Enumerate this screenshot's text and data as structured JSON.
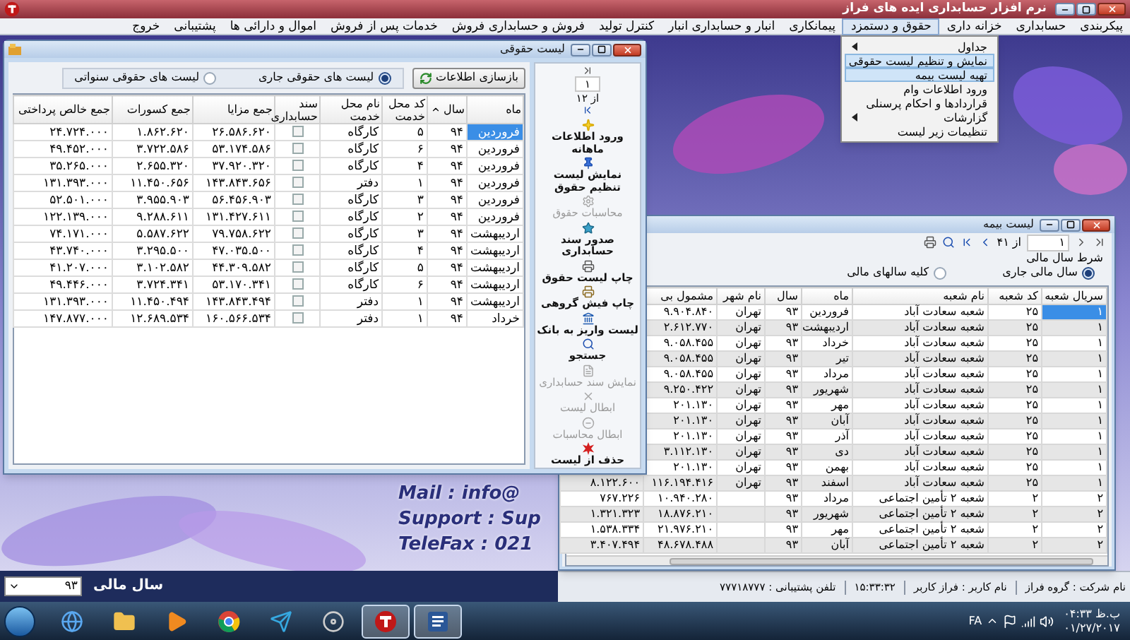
{
  "app_window": {
    "title": "نرم افزار حسابداری ایده های فراز"
  },
  "menu_bar": [
    {
      "label": "پیکربندی",
      "selected": false
    },
    {
      "label": "حسابداری",
      "selected": false
    },
    {
      "label": "خزانه داری",
      "selected": false
    },
    {
      "label": "حقوق و دستمزد",
      "selected": true
    },
    {
      "label": "پیمانکاری",
      "selected": false
    },
    {
      "label": "انبار و حسابداری انبار",
      "selected": false
    },
    {
      "label": "کنترل تولید",
      "selected": false
    },
    {
      "label": "فروش و حسابداری فروش",
      "selected": false
    },
    {
      "label": "خدمات پس از فروش",
      "selected": false
    },
    {
      "label": "اموال و دارائی ها",
      "selected": false
    },
    {
      "label": "پشتیبانی",
      "selected": false
    },
    {
      "label": "خروج",
      "selected": false
    }
  ],
  "dropdown_menu": [
    {
      "label": "جداول",
      "submenu": true,
      "selected": false
    },
    {
      "label": "نمایش و تنظیم لیست حقوقی",
      "submenu": false,
      "selected": true
    },
    {
      "label": "تهیه لیست بیمه",
      "submenu": false,
      "selected": true
    },
    {
      "label": "ورود اطلاعات وام",
      "submenu": false,
      "selected": false
    },
    {
      "label": "قراردادها و احکام پرسنلی",
      "submenu": false,
      "selected": false
    },
    {
      "label": "گزارشات",
      "submenu": true,
      "selected": false
    },
    {
      "label": "تنظیمات زیر لیست",
      "submenu": false,
      "selected": false
    }
  ],
  "payroll_window": {
    "title": "لیست حقوقی",
    "rebuild_button": "بازسازی اطلاعات",
    "list_options": [
      {
        "label": "لیست های حقوقی جاری",
        "selected": true
      },
      {
        "label": "لیست های حقوقی سنواتی",
        "selected": false
      }
    ],
    "navigator": {
      "page": "۱",
      "total": "از ۱۲"
    },
    "actions": [
      {
        "label": "ورود اطلاعات ماهانه",
        "disabled": false
      },
      {
        "label": "نمایش لیست تنظیم حقوق",
        "disabled": false
      },
      {
        "label": "محاسبات حقوق",
        "disabled": true
      },
      {
        "label": "صدور سند حسابداری",
        "disabled": false
      },
      {
        "label": "چاپ لیست حقوق",
        "disabled": false
      },
      {
        "label": "چاپ فیش گروهی",
        "disabled": false
      },
      {
        "label": "لیست واریز به بانک",
        "disabled": false
      },
      {
        "label": "جستجو",
        "disabled": false
      },
      {
        "label": "نمایش سند حسابداری",
        "disabled": true
      },
      {
        "label": "ابطال لیست",
        "disabled": true
      },
      {
        "label": "ابطال محاسبات",
        "disabled": true
      },
      {
        "label": "حذف از لیست",
        "disabled": false
      }
    ],
    "table": {
      "columns": [
        "ماه",
        "سال",
        "کد محل خدمت",
        "نام محل خدمت",
        "سند حسابداری",
        "جمع مزایا",
        "جمع کسورات",
        "جمع خالص پرداختی"
      ],
      "rows": [
        {
          "month": "فروردین",
          "year": "۹۴",
          "code": "۵",
          "place": "کارگاه",
          "checked": false,
          "benefits": "۲۶.۵۸۶.۶۲۰",
          "deductions": "۱.۸۶۲.۶۲۰",
          "net": "۲۴.۷۲۴.۰۰۰",
          "selected": true
        },
        {
          "month": "فروردین",
          "year": "۹۴",
          "code": "۶",
          "place": "کارگاه",
          "checked": false,
          "benefits": "۵۳.۱۷۴.۵۸۶",
          "deductions": "۳.۷۲۲.۵۸۶",
          "net": "۴۹.۴۵۲.۰۰۰",
          "selected": false
        },
        {
          "month": "فروردین",
          "year": "۹۴",
          "code": "۴",
          "place": "کارگاه",
          "checked": false,
          "benefits": "۳۷.۹۲۰.۳۲۰",
          "deductions": "۲.۶۵۵.۳۲۰",
          "net": "۳۵.۲۶۵.۰۰۰",
          "selected": false
        },
        {
          "month": "فروردین",
          "year": "۹۴",
          "code": "۱",
          "place": "دفتر",
          "checked": false,
          "benefits": "۱۴۳.۸۴۳.۶۵۶",
          "deductions": "۱۱.۴۵۰.۶۵۶",
          "net": "۱۳۱.۳۹۳.۰۰۰",
          "selected": false
        },
        {
          "month": "فروردین",
          "year": "۹۴",
          "code": "۳",
          "place": "کارگاه",
          "checked": false,
          "benefits": "۵۶.۴۵۶.۹۰۳",
          "deductions": "۳.۹۵۵.۹۰۳",
          "net": "۵۲.۵۰۱.۰۰۰",
          "selected": false
        },
        {
          "month": "فروردین",
          "year": "۹۴",
          "code": "۲",
          "place": "کارگاه",
          "checked": false,
          "benefits": "۱۳۱.۴۲۷.۶۱۱",
          "deductions": "۹.۲۸۸.۶۱۱",
          "net": "۱۲۲.۱۳۹.۰۰۰",
          "selected": false
        },
        {
          "month": "اردیبهشت",
          "year": "۹۴",
          "code": "۳",
          "place": "کارگاه",
          "checked": false,
          "benefits": "۷۹.۷۵۸.۶۲۲",
          "deductions": "۵.۵۸۷.۶۲۲",
          "net": "۷۴.۱۷۱.۰۰۰",
          "selected": false
        },
        {
          "month": "اردیبهشت",
          "year": "۹۴",
          "code": "۴",
          "place": "کارگاه",
          "checked": false,
          "benefits": "۴۷.۰۳۵.۵۰۰",
          "deductions": "۳.۲۹۵.۵۰۰",
          "net": "۴۳.۷۴۰.۰۰۰",
          "selected": false
        },
        {
          "month": "اردیبهشت",
          "year": "۹۴",
          "code": "۵",
          "place": "کارگاه",
          "checked": false,
          "benefits": "۴۴.۳۰۹.۵۸۲",
          "deductions": "۳.۱۰۲.۵۸۲",
          "net": "۴۱.۲۰۷.۰۰۰",
          "selected": false
        },
        {
          "month": "اردیبهشت",
          "year": "۹۴",
          "code": "۶",
          "place": "کارگاه",
          "checked": false,
          "benefits": "۵۳.۱۷۰.۳۴۱",
          "deductions": "۳.۷۲۴.۳۴۱",
          "net": "۴۹.۴۴۶.۰۰۰",
          "selected": false
        },
        {
          "month": "اردیبهشت",
          "year": "۹۴",
          "code": "۱",
          "place": "دفتر",
          "checked": false,
          "benefits": "۱۴۳.۸۴۳.۴۹۴",
          "deductions": "۱۱.۴۵۰.۴۹۴",
          "net": "۱۳۱.۳۹۳.۰۰۰",
          "selected": false
        },
        {
          "month": "خرداد",
          "year": "۹۴",
          "code": "۱",
          "place": "دفتر",
          "checked": false,
          "benefits": "۱۶۰.۵۶۶.۵۳۴",
          "deductions": "۱۲.۶۸۹.۵۳۴",
          "net": "۱۴۷.۸۷۷.۰۰۰",
          "selected": false
        }
      ]
    }
  },
  "insurance_window": {
    "title": "لیست بیمه",
    "navigator": {
      "total": "از ۴۱",
      "page": "۱"
    },
    "year_filter": {
      "title": "شرط سال مالی",
      "options": [
        {
          "label": "سال مالی جاری",
          "selected": true
        },
        {
          "label": "کلیه سالهای مالی",
          "selected": false
        }
      ]
    },
    "table": {
      "columns": [
        "سریال شعبه",
        "کد شعبه",
        "نام شعبه",
        "ماه",
        "سال",
        "نام شهر",
        "مشمول بی"
      ],
      "rows": [
        {
          "serial": "۱",
          "code": "۲۵",
          "branch": "شعبه سعادت آباد",
          "month": "فروردین",
          "year": "۹۳",
          "city": "تهران",
          "insured": "۹.۹۰۴.۸۴۰",
          "selected": true
        },
        {
          "serial": "۱",
          "code": "۲۵",
          "branch": "شعبه سعادت آباد",
          "month": "اردیبهشت",
          "year": "۹۳",
          "city": "تهران",
          "insured": "۲.۶۱۲.۷۷۰",
          "selected": false
        },
        {
          "serial": "۱",
          "code": "۲۵",
          "branch": "شعبه سعادت آباد",
          "month": "خرداد",
          "year": "۹۳",
          "city": "تهران",
          "insured": "۹.۰۵۸.۴۵۵",
          "selected": false
        },
        {
          "serial": "۱",
          "code": "۲۵",
          "branch": "شعبه سعادت آباد",
          "month": "تیر",
          "year": "۹۳",
          "city": "تهران",
          "insured": "۹.۰۵۸.۴۵۵",
          "selected": false
        },
        {
          "serial": "۱",
          "code": "۲۵",
          "branch": "شعبه سعادت آباد",
          "month": "مرداد",
          "year": "۹۳",
          "city": "تهران",
          "insured": "۹.۰۵۸.۴۵۵",
          "selected": false
        },
        {
          "serial": "۱",
          "code": "۲۵",
          "branch": "شعبه سعادت آباد",
          "month": "شهریور",
          "year": "۹۳",
          "city": "تهران",
          "insured": "۹.۲۵۰.۴۲۲",
          "selected": false
        },
        {
          "serial": "۱",
          "code": "۲۵",
          "branch": "شعبه سعادت آباد",
          "month": "مهر",
          "year": "۹۳",
          "city": "تهران",
          "insured": "۲۰۱.۱۳۰",
          "selected": false
        },
        {
          "serial": "۱",
          "code": "۲۵",
          "branch": "شعبه سعادت آباد",
          "month": "آبان",
          "year": "۹۳",
          "city": "تهران",
          "insured": "۲۰۱.۱۳۰",
          "selected": false
        },
        {
          "serial": "۱",
          "code": "۲۵",
          "branch": "شعبه سعادت آباد",
          "month": "آذر",
          "year": "۹۳",
          "city": "تهران",
          "insured": "۲۰۱.۱۳۰",
          "selected": false
        },
        {
          "serial": "۱",
          "code": "۲۵",
          "branch": "شعبه سعادت آباد",
          "month": "دی",
          "year": "۹۳",
          "city": "تهران",
          "insured": "۳.۱۱۲.۱۳۰",
          "selected": false
        },
        {
          "serial": "۱",
          "code": "۲۵",
          "branch": "شعبه سعادت آباد",
          "month": "بهمن",
          "year": "۹۳",
          "city": "تهران",
          "insured": "۲۰۱.۱۳۰",
          "selected": false
        },
        {
          "serial": "۱",
          "code": "۲۵",
          "branch": "شعبه سعادت آباد",
          "month": "اسفند",
          "year": "۹۳",
          "city": "تهران",
          "insured": "۱۱۶.۱۹۴.۴۱۶",
          "column_8": "۸.۱۲۲.۶۰۰",
          "selected": false
        },
        {
          "serial": "۲",
          "code": "۲",
          "branch": "شعبه ۲ تأمین اجتماعی",
          "month": "مرداد",
          "year": "۹۳",
          "insured": "۱۰.۹۴۰.۲۸۰",
          "column_8": "۷۶۷.۲۲۶",
          "selected": false
        },
        {
          "serial": "۲",
          "code": "۲",
          "branch": "شعبه ۲ تأمین اجتماعی",
          "month": "شهریور",
          "year": "۹۳",
          "insured": "۱۸.۸۷۶.۲۱۰",
          "column_8": "۱.۳۲۱.۳۲۳",
          "selected": false
        },
        {
          "serial": "۲",
          "code": "۲",
          "branch": "شعبه ۲ تأمین اجتماعی",
          "month": "مهر",
          "year": "۹۳",
          "insured": "۲۱.۹۷۶.۲۱۰",
          "column_8": "۱.۵۳۸.۳۳۴",
          "selected": false
        },
        {
          "serial": "۲",
          "code": "۲",
          "branch": "شعبه ۲ تأمین اجتماعی",
          "month": "آبان",
          "year": "۹۳",
          "insured": "۴۸.۶۷۸.۴۸۸",
          "column_8": "۳.۴۰۷.۴۹۴",
          "selected": false
        }
      ]
    }
  },
  "background_contact": [
    "Mail : info@",
    "Support : Sup",
    "TeleFax : 021"
  ],
  "fiscal_year": {
    "label": "سال مالی",
    "value": "۹۳"
  },
  "status_bar": [
    "نام شرکت : گروه فراز",
    "نام کاربر : فراز کاربر",
    "۱۵:۳۳:۳۲",
    "تلفن پشتیبانی : ۷۷۷۱۸۷۷۷"
  ],
  "taskbar": {
    "apps": [
      {
        "active": false
      },
      {
        "active": false
      },
      {
        "active": false
      },
      {
        "active": false
      },
      {
        "active": false
      },
      {
        "active": false
      },
      {
        "active": true
      },
      {
        "active": true
      }
    ],
    "tray": {
      "language": "FA",
      "time": "ب.ظ ۰۴:۳۳",
      "date": "۰۱/۲۷/۲۰۱۷"
    }
  }
}
